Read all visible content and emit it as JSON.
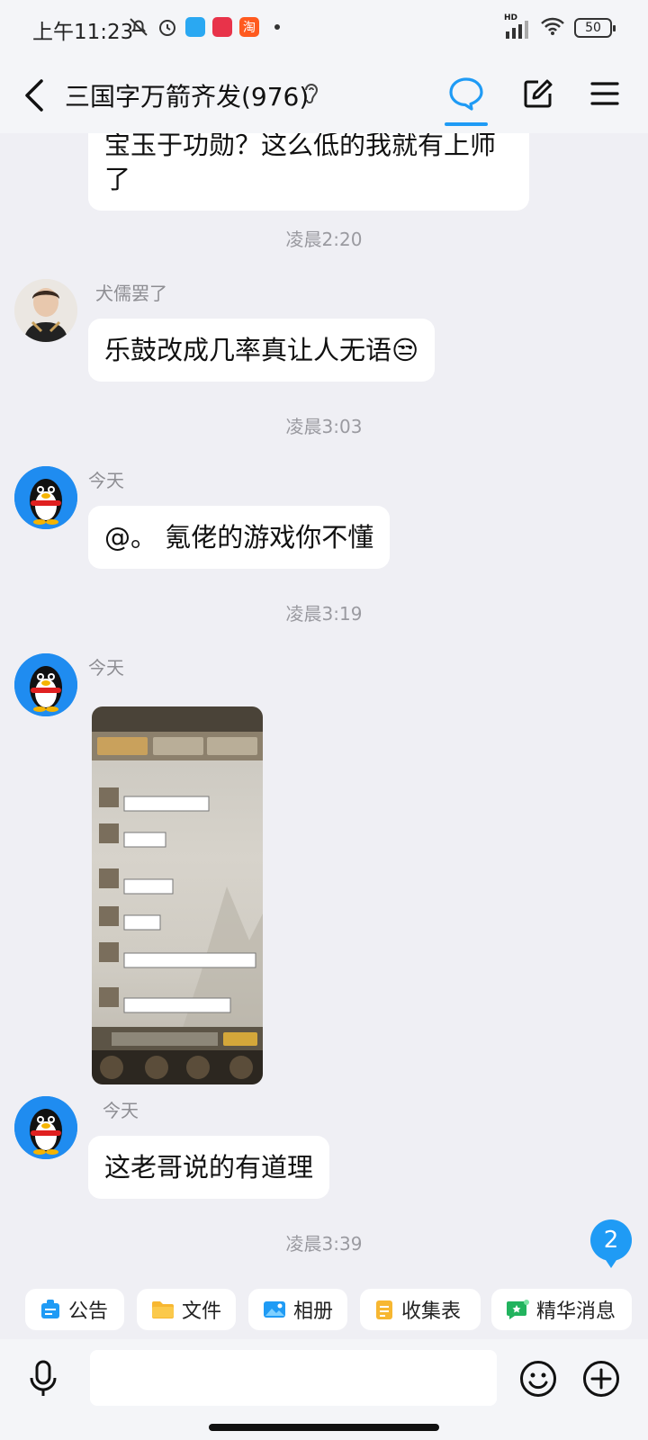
{
  "status_bar": {
    "time": "上午11:23",
    "battery": "50",
    "network": "HD",
    "app_badge_label": "淘"
  },
  "header": {
    "title": "三国字万箭齐发(976)"
  },
  "messages": [
    {
      "type": "text",
      "text": "宝玉于功勋？这么低的我就有上师了"
    },
    {
      "type": "time",
      "text": "凌晨2:20"
    },
    {
      "type": "text",
      "sender": "犬儒罢了",
      "text": "乐鼓改成几率真让人无语😒"
    },
    {
      "type": "time",
      "text": "凌晨3:03"
    },
    {
      "type": "text",
      "sender": "今天",
      "text": "@。 氪佬的游戏你不懂"
    },
    {
      "type": "time",
      "text": "凌晨3:19"
    },
    {
      "type": "image",
      "sender": "今天"
    },
    {
      "type": "text",
      "sender": "今天",
      "text": "这老哥说的有道理"
    },
    {
      "type": "time",
      "text": "凌晨3:39"
    }
  ],
  "unread_count": "2",
  "quick_tools": [
    {
      "label": "公告",
      "icon": "announcement-icon",
      "color": "#1f9bf5"
    },
    {
      "label": "文件",
      "icon": "folder-icon",
      "color": "#f7b731"
    },
    {
      "label": "相册",
      "icon": "album-icon",
      "color": "#1f9bf5"
    },
    {
      "label": "收集表",
      "icon": "form-icon",
      "color": "#f7b731"
    },
    {
      "label": "精华消息",
      "icon": "essence-icon",
      "color": "#22b35e"
    }
  ],
  "input": {
    "placeholder": ""
  },
  "colors": {
    "accent": "#1f9bf5",
    "background": "#efeff4",
    "bubble": "#ffffff"
  }
}
